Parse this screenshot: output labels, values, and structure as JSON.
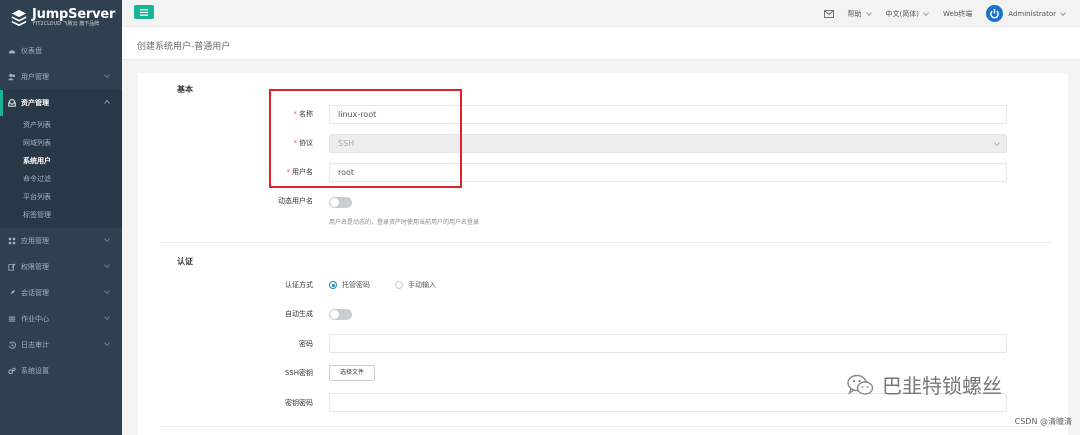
{
  "brand": {
    "title": "JumpServer",
    "subtitle": "FIT2CLOUD 飞致云 旗下品牌",
    "accent": "#1ab394"
  },
  "sidebar": {
    "items": [
      {
        "label": "仪表盘",
        "icon": "dashboard-icon",
        "expandable": false
      },
      {
        "label": "用户管理",
        "icon": "users-icon",
        "expandable": true
      },
      {
        "label": "资产管理",
        "icon": "inbox-icon",
        "expandable": true,
        "active": true,
        "children": [
          "资产列表",
          "网域列表",
          "系统用户",
          "命令过滤",
          "平台列表",
          "标签管理"
        ],
        "current": "系统用户"
      },
      {
        "label": "应用管理",
        "icon": "grid-icon",
        "expandable": true
      },
      {
        "label": "权限管理",
        "icon": "edit-icon",
        "expandable": true
      },
      {
        "label": "会话管理",
        "icon": "rocket-icon",
        "expandable": true
      },
      {
        "label": "作业中心",
        "icon": "list-icon",
        "expandable": true
      },
      {
        "label": "日志审计",
        "icon": "history-icon",
        "expandable": true
      },
      {
        "label": "系统设置",
        "icon": "gears-icon",
        "expandable": false
      }
    ]
  },
  "topbar": {
    "help": "帮助",
    "language": "中文(简体)",
    "terminal": "Web终端",
    "user": "Administrator"
  },
  "page": {
    "title": "创建系统用户-普通用户"
  },
  "form": {
    "basic": {
      "section": "基本",
      "name_label": "名称",
      "name_value": "linux-root",
      "protocol_label": "协议",
      "protocol_value": "SSH",
      "username_label": "用户名",
      "username_value": "root",
      "dynamic_label": "动态用户名",
      "dynamic_help": "用户名是动态的，登录资产时使用当前用户的用户名登录"
    },
    "auth": {
      "section": "认证",
      "method_label": "认证方式",
      "method_options": [
        "托管密码",
        "手动输入"
      ],
      "method_selected": "托管密码",
      "autogen_label": "自动生成",
      "password_label": "密码",
      "ssh_key_label": "SSH密钥",
      "choose_file": "选择文件",
      "key_passphrase_label": "密钥密码"
    }
  },
  "watermark": {
    "text": "巴韭特锁螺丝",
    "csdn": "CSDN @清瞳清"
  }
}
